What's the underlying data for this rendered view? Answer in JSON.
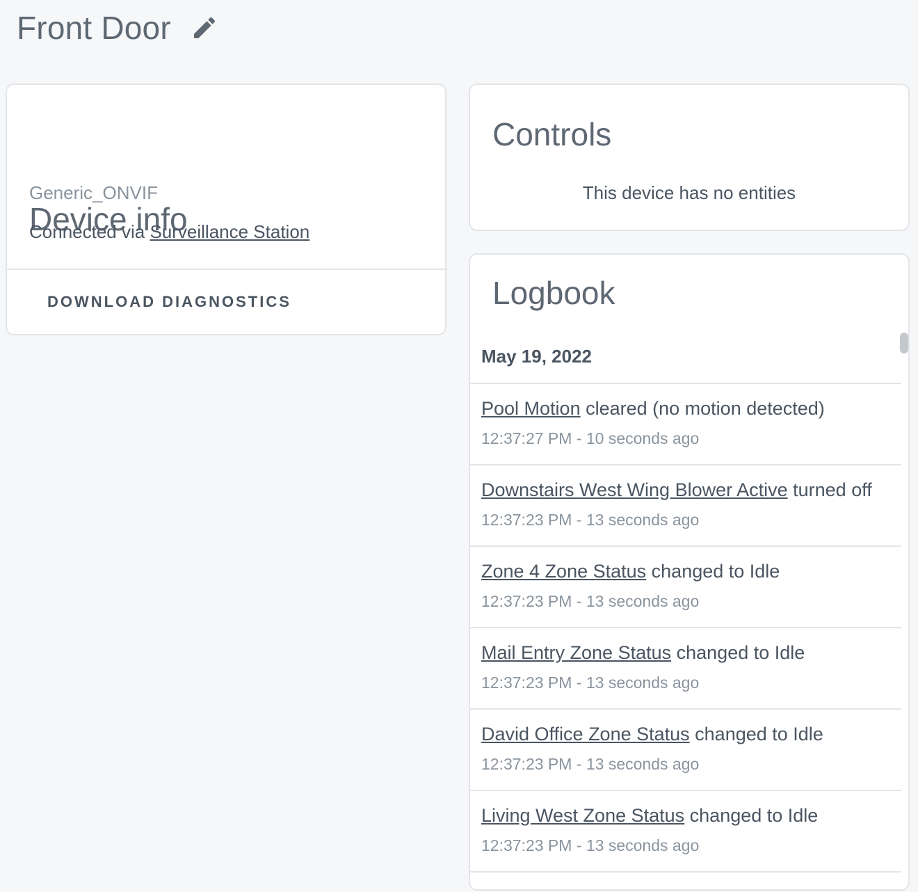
{
  "header": {
    "title": "Front Door",
    "edit_icon": "pencil-icon"
  },
  "device_info": {
    "title": "Device info",
    "model": "Generic_ONVIF",
    "connected_prefix": "Connected via ",
    "connected_link": "Surveillance Station",
    "download_button": "DOWNLOAD DIAGNOSTICS"
  },
  "controls": {
    "title": "Controls",
    "empty_text": "This device has no entities"
  },
  "logbook": {
    "title": "Logbook",
    "date": "May 19, 2022",
    "entries": [
      {
        "entity": "Pool Motion",
        "action": " cleared (no motion detected)",
        "time": "12:37:27 PM - 10 seconds ago"
      },
      {
        "entity": "Downstairs West Wing Blower Active",
        "action": " turned off",
        "time": "12:37:23 PM - 13 seconds ago"
      },
      {
        "entity": "Zone 4 Zone Status",
        "action": " changed to Idle",
        "time": "12:37:23 PM - 13 seconds ago"
      },
      {
        "entity": "Mail Entry Zone Status",
        "action": " changed to Idle",
        "time": "12:37:23 PM - 13 seconds ago"
      },
      {
        "entity": "David Office Zone Status",
        "action": " changed to Idle",
        "time": "12:37:23 PM - 13 seconds ago"
      },
      {
        "entity": "Living West Zone Status",
        "action": " changed to Idle",
        "time": "12:37:23 PM - 13 seconds ago"
      }
    ]
  },
  "colors": {
    "background": "#f6f7f9",
    "card": "#ffffff",
    "text": "#4a5561",
    "secondary_text": "#8a949e",
    "divider": "#e3e5e8"
  }
}
